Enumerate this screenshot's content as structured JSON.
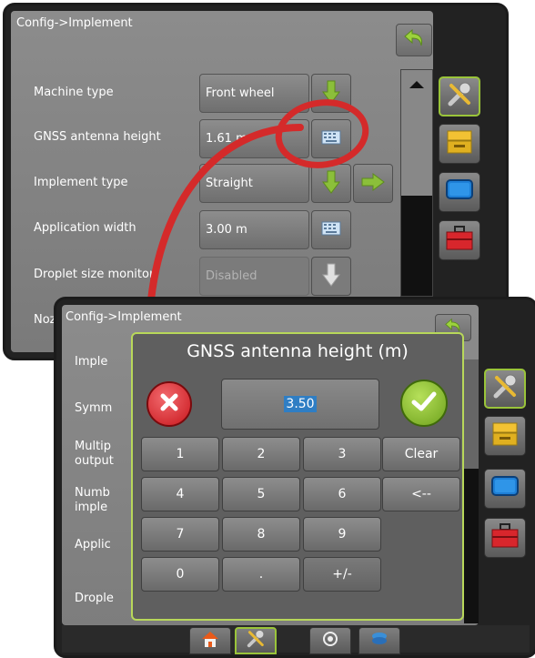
{
  "back_screen": {
    "breadcrumb": "Config->Implement",
    "rows": [
      {
        "label": "Machine type",
        "value": "Front wheel"
      },
      {
        "label": "GNSS antenna height",
        "value": "1.61 m"
      },
      {
        "label": "Implement type",
        "value": "Straight"
      },
      {
        "label": "Application width",
        "value": "3.00 m"
      },
      {
        "label": "Droplet size monitor",
        "value": "Disabled"
      }
    ],
    "partial_label": "Noz"
  },
  "front_screen": {
    "breadcrumb": "Config->Implement",
    "partial_labels": [
      "Imple",
      "Symm",
      "Multip",
      "output",
      "Numb",
      "imple",
      "Applic",
      "Drople"
    ]
  },
  "dialog": {
    "title": "GNSS antenna height (m)",
    "value": "3.50",
    "keys": [
      "1",
      "2",
      "3",
      "Clear",
      "4",
      "5",
      "6",
      "<--",
      "7",
      "8",
      "9",
      "0",
      ".",
      "+/-"
    ]
  },
  "colors": {
    "accent_green": "#8bbf3a",
    "cancel_red": "#d8262c",
    "highlight_red": "#d42a2a",
    "dialog_border": "#b8d85a",
    "value_highlight": "#2f7ec4"
  },
  "icons": {
    "back": "undo-arrow-icon",
    "tools": "wrench-screwdriver-icon",
    "console": "console-icon",
    "display": "display-icon",
    "toolbox": "toolbox-icon",
    "home": "home-icon",
    "gnss": "gnss-icon",
    "layers": "layers-icon"
  }
}
